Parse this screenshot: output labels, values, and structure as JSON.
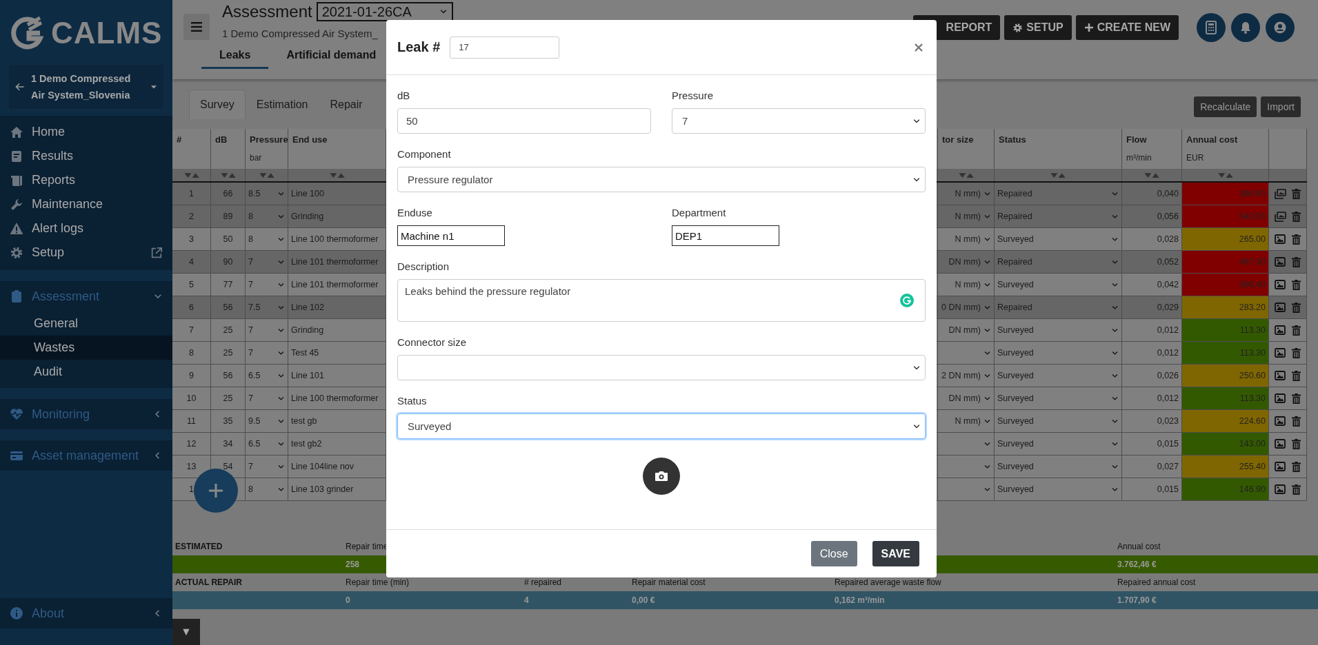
{
  "sidebar": {
    "logo": "CALMS",
    "project": "1 Demo Compressed Air System_Slovenia",
    "menu": [
      {
        "label": "Home",
        "external": false
      },
      {
        "label": "Results",
        "external": false
      },
      {
        "label": "Reports",
        "external": false
      },
      {
        "label": "Maintenance",
        "external": false
      },
      {
        "label": "Alert logs",
        "external": false
      },
      {
        "label": "Setup",
        "external": true
      }
    ],
    "sections": [
      {
        "label": "Assessment",
        "expanded": true,
        "children": [
          {
            "label": "General",
            "selected": false
          },
          {
            "label": "Wastes",
            "selected": true
          },
          {
            "label": "Audit",
            "selected": false
          }
        ]
      },
      {
        "label": "Monitoring",
        "expanded": false
      },
      {
        "label": "Asset management",
        "expanded": false
      }
    ],
    "about": {
      "label": "About",
      "expanded": false
    }
  },
  "header": {
    "title": "Assessment",
    "assessment": "2021-01-26CA",
    "subtitle": "1 Demo Compressed Air System_",
    "tabs": [
      {
        "label": "Leaks",
        "selected": true
      },
      {
        "label": "Artificial demand",
        "selected": false
      }
    ],
    "buttons": [
      {
        "label": "REPORT",
        "kind": "report"
      },
      {
        "label": "SETUP",
        "kind": "setup"
      },
      {
        "label": "CREATE NEW",
        "kind": "create"
      }
    ]
  },
  "toolbar": {
    "tabs": [
      {
        "label": "Survey",
        "selected": true
      },
      {
        "label": "Estimation",
        "selected": false
      },
      {
        "label": "Repair",
        "selected": false
      }
    ],
    "buttons": [
      "Recalculate",
      "Import"
    ]
  },
  "table": {
    "columns": [
      {
        "label": "#"
      },
      {
        "label": "dB"
      },
      {
        "label": "Pressure",
        "unit": "bar"
      },
      {
        "label": "End use"
      },
      {
        "label": "tor size"
      },
      {
        "label": "Status"
      },
      {
        "label": "Flow",
        "unit": "m³/min"
      },
      {
        "label": "Annual cost",
        "unit": "EUR"
      }
    ],
    "rows": [
      {
        "number": "1",
        "db": "66",
        "pressure": "8.5",
        "end_use": "Line 100",
        "column_5": "N mm)",
        "status": "Repaired",
        "repaired": true,
        "flow": "0,040",
        "annual_cost": "386.90",
        "color": "#800000",
        "multiple_photos": true
      },
      {
        "number": "2",
        "db": "89",
        "pressure": "8",
        "end_use": "Grinding",
        "column_5": "N mm)",
        "status": "Repaired",
        "repaired": true,
        "flow": "0,056",
        "annual_cost": "540.50",
        "color": "#800000",
        "multiple_photos": true
      },
      {
        "number": "3",
        "db": "50",
        "pressure": "8",
        "end_use": "Line 100 thermoformer",
        "column_5": "N mm)",
        "status": "Surveyed",
        "repaired": false,
        "flow": "0,028",
        "annual_cost": "265.00",
        "color": "#806600",
        "multiple_photos": false
      },
      {
        "number": "4",
        "db": "90",
        "pressure": "7",
        "end_use": "Line 101 thermoformer",
        "column_5": "DN mm)",
        "status": "Repaired",
        "repaired": true,
        "flow": "0,052",
        "annual_cost": "497.30",
        "color": "#800000",
        "multiple_photos": false
      },
      {
        "number": "5",
        "db": "77",
        "pressure": "7",
        "end_use": "Line 101 thermoformer",
        "column_5": "N mm)",
        "status": "Surveyed",
        "repaired": false,
        "flow": "0,042",
        "annual_cost": "399.40",
        "color": "#800000",
        "multiple_photos": false
      },
      {
        "number": "6",
        "db": "56",
        "pressure": "7.5",
        "end_use": "Line 102",
        "column_5": "0 DN mm)",
        "status": "Repaired",
        "repaired": true,
        "flow": "0,029",
        "annual_cost": "283.20",
        "color": "#806600",
        "multiple_photos": false
      },
      {
        "number": "7",
        "db": "25",
        "pressure": "7",
        "end_use": "Grinding",
        "column_5": "DN mm)",
        "status": "Surveyed",
        "repaired": false,
        "flow": "0,012",
        "annual_cost": "113.30",
        "color": "#335900",
        "multiple_photos": false
      },
      {
        "number": "8",
        "db": "25",
        "pressure": "7",
        "end_use": "Test 45",
        "status": "Surveyed",
        "repaired": false,
        "flow": "0,012",
        "annual_cost": "113.30",
        "color": "#335900",
        "multiple_photos": false
      },
      {
        "number": "9",
        "db": "56",
        "pressure": "6.5",
        "end_use": "Line 101",
        "column_5": "2 DN mm)",
        "status": "Surveyed",
        "repaired": false,
        "flow": "0,026",
        "annual_cost": "250.60",
        "color": "#806600",
        "multiple_photos": false
      },
      {
        "number": "10",
        "db": "25",
        "pressure": "7",
        "end_use": "Line 100 thermoformer",
        "column_5": "DN mm)",
        "status": "Surveyed",
        "repaired": false,
        "flow": "0,012",
        "annual_cost": "113.30",
        "color": "#335900",
        "multiple_photos": false
      },
      {
        "number": "11",
        "db": "35",
        "pressure": "9.5",
        "end_use": "test gb",
        "column_5": "N mm)",
        "status": "Surveyed",
        "repaired": false,
        "flow": "0,023",
        "annual_cost": "224.60",
        "color": "#806600",
        "multiple_photos": false
      },
      {
        "number": "12",
        "db": "34",
        "pressure": "6.5",
        "end_use": "test gb2",
        "status": "Surveyed",
        "repaired": false,
        "flow": "0,015",
        "annual_cost": "143.00",
        "color": "#335900",
        "multiple_photos": false
      },
      {
        "number": "13",
        "db": "54",
        "pressure": "7",
        "end_use": "Line 104line nov",
        "status": "Surveyed",
        "repaired": false,
        "flow": "0,027",
        "annual_cost": "255.40",
        "color": "#806600",
        "multiple_photos": false
      },
      {
        "number": "1",
        "pressure": "8",
        "end_use": "Line 103 grinder",
        "status": "Surveyed",
        "repaired": false,
        "flow": "0,015",
        "annual_cost": "146.90",
        "color": "#335900",
        "multiple_photos": false
      }
    ]
  },
  "summary": [
    {
      "label": "ESTIMATED",
      "kind": "estimated",
      "fields": [
        {
          "label": "Repair time",
          "value": "258"
        },
        {
          "label": "Annual cost",
          "value": "3.762,46 €"
        }
      ]
    },
    {
      "label": "ACTUAL REPAIR",
      "kind": "actual",
      "fields": [
        {
          "label": "Repair time (min)",
          "value": "0"
        },
        {
          "label": "# repaired",
          "value": "4"
        },
        {
          "label": "Repair material cost",
          "value": "0,00 €"
        },
        {
          "label": "Repaired average waste flow",
          "value": "0,162 m³/min"
        },
        {
          "label": "Repaired annual cost",
          "value": "1.707,90 €"
        }
      ]
    }
  ],
  "toggle": "▼",
  "modal": {
    "title": "Leak #",
    "number": "17",
    "rows": [
      [
        {
          "kind": "input",
          "label": "dB",
          "value": "50",
          "focused": false
        },
        {
          "kind": "select",
          "label": "Pressure",
          "value": "7",
          "focused": false
        }
      ],
      [
        {
          "kind": "select",
          "label": "Component",
          "value": "Pressure regulator",
          "focused": false
        }
      ],
      [
        {
          "kind": "plain",
          "label": "Enduse",
          "value": "Machine n1",
          "focused": false
        },
        {
          "kind": "plain",
          "label": "Department",
          "value": "DEP1",
          "focused": false
        }
      ],
      [
        {
          "kind": "textarea",
          "label": "Description",
          "value": "Leaks behind the pressure regulator",
          "focused": false
        }
      ],
      [
        {
          "kind": "select",
          "label": "Connector size",
          "focused": false
        }
      ],
      [
        {
          "kind": "select",
          "label": "Status",
          "value": "Surveyed",
          "focused": true
        }
      ]
    ],
    "buttons": [
      {
        "label": "Close",
        "kind": "secondary"
      },
      {
        "label": "SAVE",
        "kind": "primary"
      }
    ]
  }
}
